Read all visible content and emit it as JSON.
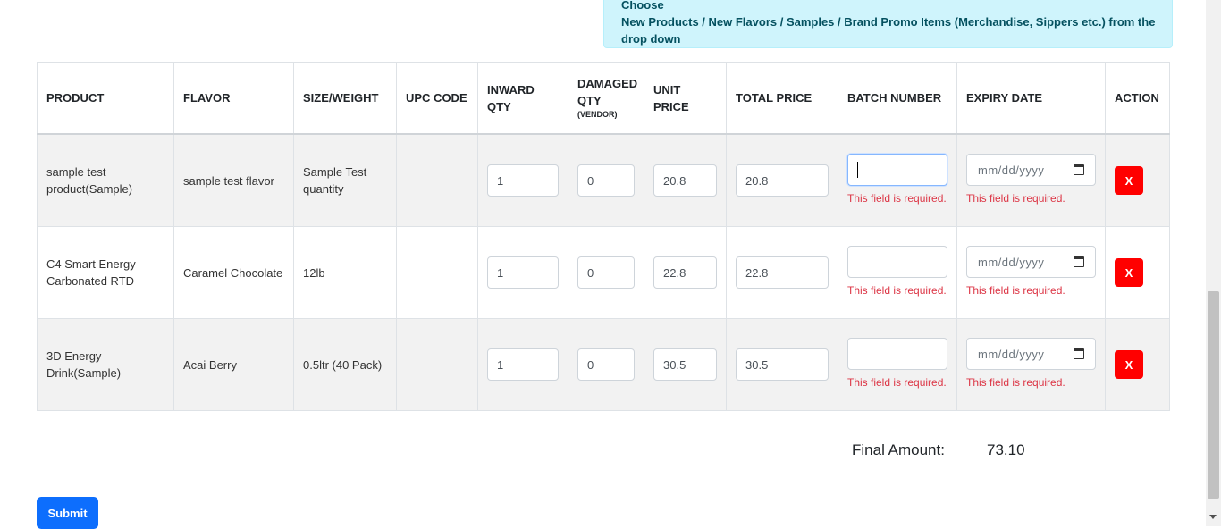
{
  "info": {
    "line1": "Choose",
    "line2": "New Products / New Flavors / Samples / Brand Promo Items (Merchandise, Sippers etc.) from the drop down"
  },
  "table": {
    "headers": {
      "product": "PRODUCT",
      "flavor": "FLAVOR",
      "size": "SIZE/WEIGHT",
      "upc": "UPC CODE",
      "inward": "INWARD QTY",
      "damaged": "DAMAGED QTY",
      "damaged_sub": "(VENDOR)",
      "unit_price": "UNIT PRICE",
      "total_price": "TOTAL PRICE",
      "batch": "BATCH NUMBER",
      "expiry": "EXPIRY DATE",
      "action": "ACTION"
    },
    "rows": [
      {
        "product": "sample test product(Sample)",
        "flavor": "sample test flavor",
        "size": "Sample Test quantity",
        "upc": "",
        "inward": "1",
        "damaged": "0",
        "unit_price": "20.8",
        "total_price": "20.8",
        "batch": "",
        "expiry_placeholder": "mm/dd/yyyy",
        "batch_error": "This field is required.",
        "expiry_error": "This field is required.",
        "action_label": "X"
      },
      {
        "product": "C4 Smart Energy Carbonated RTD",
        "flavor": "Caramel Chocolate",
        "size": "12lb",
        "upc": "",
        "inward": "1",
        "damaged": "0",
        "unit_price": "22.8",
        "total_price": "22.8",
        "batch": "",
        "expiry_placeholder": "mm/dd/yyyy",
        "batch_error": "This field is required.",
        "expiry_error": "This field is required.",
        "action_label": "X"
      },
      {
        "product": "3D Energy Drink(Sample)",
        "flavor": "Acai Berry",
        "size": "0.5ltr (40 Pack)",
        "upc": "",
        "inward": "1",
        "damaged": "0",
        "unit_price": "30.5",
        "total_price": "30.5",
        "batch": "",
        "expiry_placeholder": "mm/dd/yyyy",
        "batch_error": "This field is required.",
        "expiry_error": "This field is required.",
        "action_label": "X"
      }
    ]
  },
  "summary": {
    "final_label": "Final Amount:",
    "final_value": "73.10"
  },
  "submit_label": "Submit",
  "colors": {
    "danger": "#ff0000",
    "primary": "#0d6efd",
    "info_bg": "#cff4fc",
    "error_text": "#dc3545"
  },
  "icons": {
    "calendar": "calendar-icon"
  }
}
